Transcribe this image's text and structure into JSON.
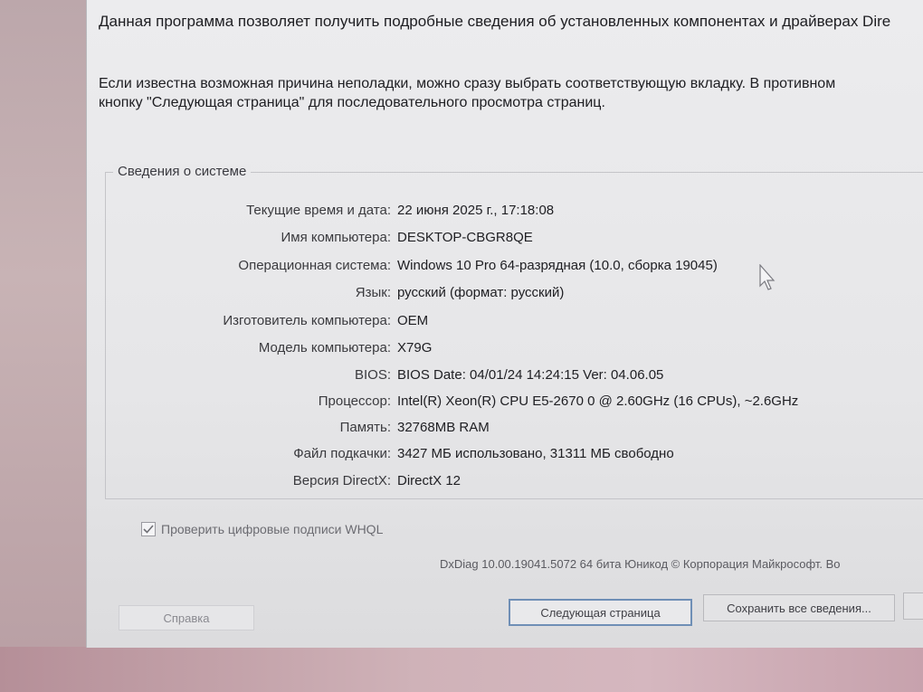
{
  "intro": {
    "line1": "Данная программа позволяет получить подробные сведения об установленных компонентах и драйверах Dire",
    "line2a": "Если известна возможная причина неполадки, можно сразу выбрать соответствующую вкладку. В противном",
    "line2b": "кнопку \"Следующая страница\" для последовательного просмотра страниц."
  },
  "system_info": {
    "title": "Сведения о системе",
    "rows": [
      {
        "label": "Текущие время и дата:",
        "value": "22 июня 2025 г., 17:18:08"
      },
      {
        "label": "Имя компьютера:",
        "value": "DESKTOP-CBGR8QE"
      },
      {
        "label": "Операционная система:",
        "value": "Windows 10 Pro 64-разрядная (10.0, сборка 19045)"
      },
      {
        "label": "Язык:",
        "value": "русский (формат: русский)"
      },
      {
        "label": "Изготовитель компьютера:",
        "value": "OEM"
      },
      {
        "label": "Модель компьютера:",
        "value": "X79G"
      },
      {
        "label": "BIOS:",
        "value": "BIOS Date: 04/01/24 14:24:15 Ver: 04.06.05"
      },
      {
        "label": "Процессор:",
        "value": "Intel(R) Xeon(R) CPU E5-2670 0 @ 2.60GHz (16 CPUs), ~2.6GHz"
      },
      {
        "label": "Память:",
        "value": "32768MB RAM"
      },
      {
        "label": "Файл подкачки:",
        "value": "3427 МБ использовано, 31311 МБ свободно"
      },
      {
        "label": "Версия DirectX:",
        "value": "DirectX 12"
      }
    ]
  },
  "whql": {
    "label": "Проверить цифровые подписи WHQL",
    "checked": true
  },
  "footer": "DxDiag 10.00.19041.5072 64 бита Юникод © Корпорация Майкрософт. Во",
  "buttons": {
    "help": "Справка",
    "next": "Следующая страница",
    "save": "Сохранить все сведения..."
  }
}
